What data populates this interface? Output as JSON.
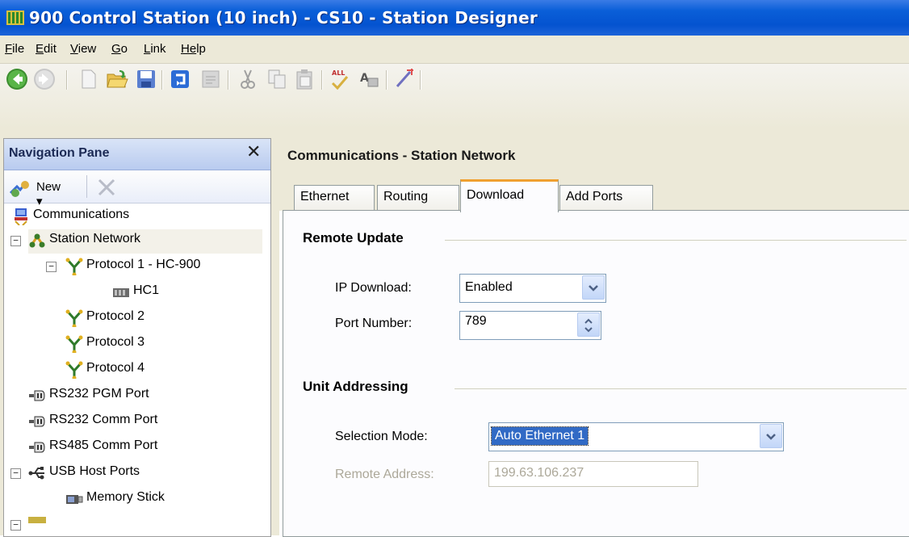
{
  "window": {
    "title": "900 Control Station (10 inch) - CS10 - Station Designer"
  },
  "menu": {
    "items": [
      {
        "label": "File",
        "accel": "F",
        "rest": "ile"
      },
      {
        "label": "Edit",
        "accel": "E",
        "rest": "dit"
      },
      {
        "label": "View",
        "accel": "V",
        "rest": "iew"
      },
      {
        "label": "Go",
        "accel": "G",
        "rest": "o"
      },
      {
        "label": "Link",
        "accel": "L",
        "rest": "ink"
      },
      {
        "label": "Help",
        "accel": "He",
        "rest": "lp"
      }
    ]
  },
  "toolbar": {
    "icons": [
      "back-icon",
      "forward-icon",
      "new-file-icon",
      "open-folder-icon",
      "save-icon",
      "restore-icon",
      "page-icon",
      "cut-icon",
      "copy-icon",
      "paste-icon",
      "spell-check-all-icon",
      "find-icon",
      "wand-icon"
    ]
  },
  "nav": {
    "title": "Navigation Pane",
    "close_glyph": "✕",
    "new_label": "New ▾",
    "tree": [
      {
        "label": "Communications",
        "icon": "communications-icon"
      },
      {
        "label": "Station Network",
        "icon": "network-icon"
      },
      {
        "label": "Protocol 1 - HC-900",
        "icon": "protocol-icon"
      },
      {
        "label": "HC1",
        "icon": "controller-icon"
      },
      {
        "label": "Protocol 2",
        "icon": "protocol-icon"
      },
      {
        "label": "Protocol 3",
        "icon": "protocol-icon"
      },
      {
        "label": "Protocol 4",
        "icon": "protocol-icon"
      },
      {
        "label": "RS232 PGM Port",
        "icon": "serial-port-icon"
      },
      {
        "label": "RS232 Comm Port",
        "icon": "serial-port-icon"
      },
      {
        "label": "RS485 Comm Port",
        "icon": "serial-port-icon"
      },
      {
        "label": "USB Host Ports",
        "icon": "usb-icon"
      },
      {
        "label": "Memory Stick",
        "icon": "memory-stick-icon"
      }
    ]
  },
  "main": {
    "title": "Communications - Station Network",
    "tabs": [
      "Ethernet",
      "Routing",
      "Download",
      "Add Ports"
    ],
    "active_tab": "Download",
    "remote_update": {
      "heading": "Remote Update",
      "ip_download_label": "IP Download:",
      "ip_download_value": "Enabled",
      "port_number_label": "Port Number:",
      "port_number_value": "789"
    },
    "unit_addressing": {
      "heading": "Unit Addressing",
      "selection_mode_label": "Selection Mode:",
      "selection_mode_value": "Auto Ethernet 1",
      "remote_address_label": "Remote Address:",
      "remote_address_value": "199.63.106.237"
    }
  },
  "colors": {
    "titlebar": "#0453d0",
    "accent_tab": "#f0a030",
    "selection": "#316ac5"
  }
}
